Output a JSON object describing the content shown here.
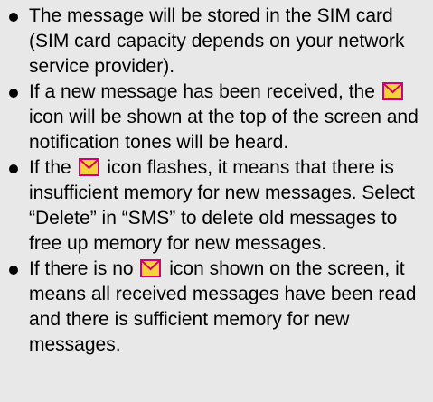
{
  "notes": {
    "item1": {
      "text": "The message will be stored in the SIM card (SIM card capacity depends on your network service provider)."
    },
    "item2": {
      "before": "If a new message has been received, the",
      "after": "icon will be shown at the top of the screen and notification tones will be heard."
    },
    "item3": {
      "before": "If the",
      "after": "icon flashes, it means that there is insufficient memory for new messages. Select “Delete” in “SMS” to delete old messages to free up memory for new messages."
    },
    "item4": {
      "before": "If there is no",
      "after": "icon shown on the screen, it means all received messages have been read and there is sufficient memory for new messages."
    }
  },
  "icons": {
    "message": "envelope-icon"
  },
  "colors": {
    "background": "#e8e8e8",
    "text": "#000000",
    "envelope_fill": "#f3d23a",
    "envelope_border": "#d6006b"
  }
}
